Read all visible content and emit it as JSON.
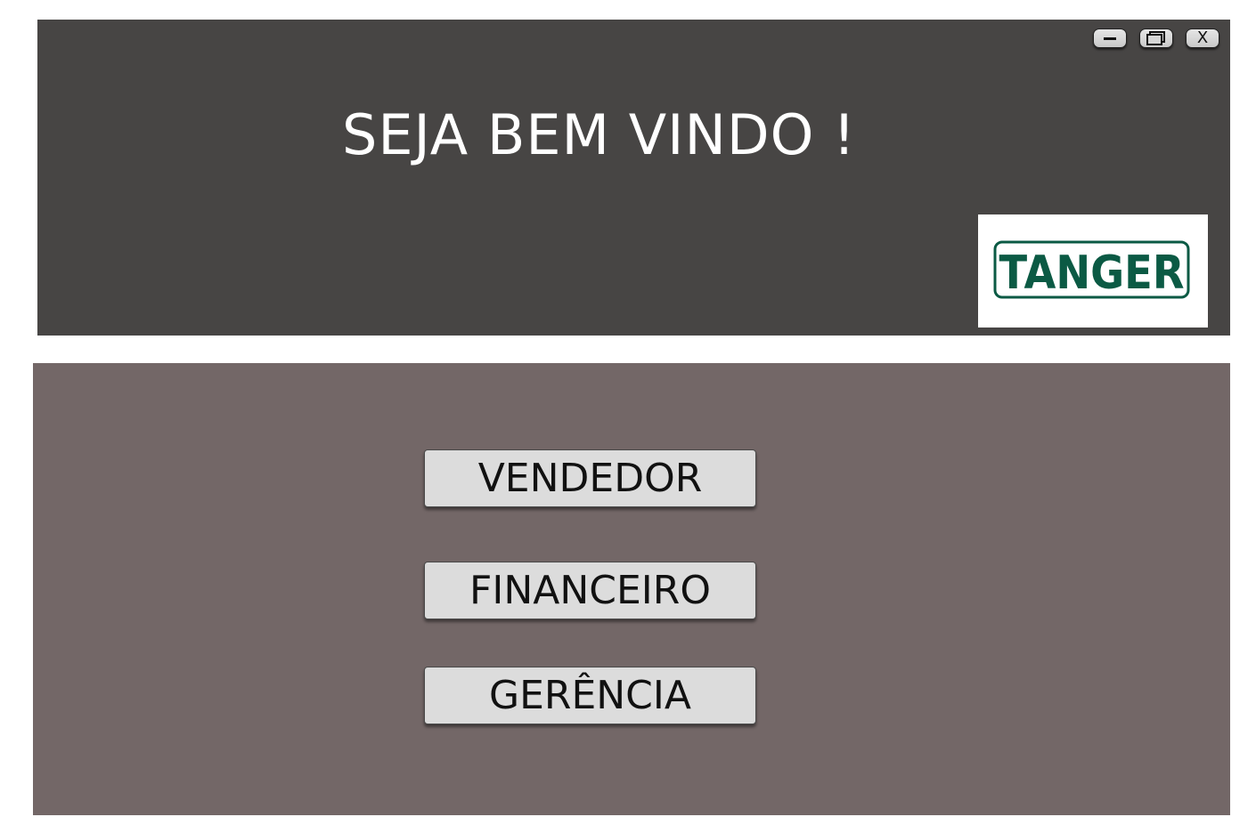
{
  "header": {
    "title": "SEJA BEM VINDO !",
    "background": "#474544",
    "window_controls": {
      "minimize_icon": "minimize-icon",
      "maximize_icon": "restore-icon",
      "close_label": "X"
    },
    "logo": {
      "text": "TANGER",
      "color": "#0b5a44"
    }
  },
  "main": {
    "background": "#736767",
    "buttons": {
      "vendedor": "VENDEDOR",
      "financeiro": "FINANCEIRO",
      "gerencia": "GERÊNCIA"
    }
  }
}
